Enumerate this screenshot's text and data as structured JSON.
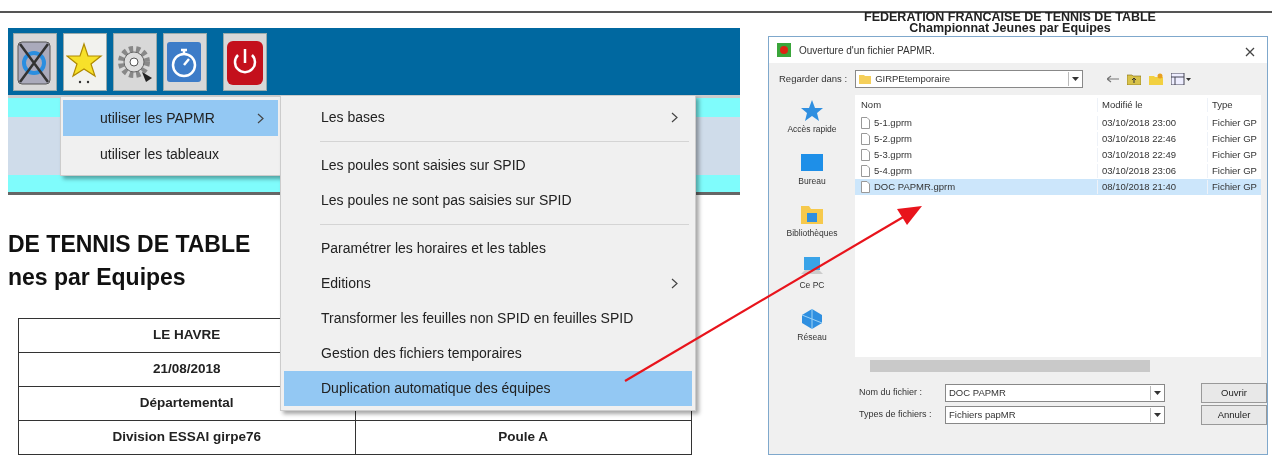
{
  "toolbar": {
    "buttons": [
      {
        "kind": "sync",
        "selected": false
      },
      {
        "kind": "star",
        "selected": true
      },
      {
        "kind": "gear",
        "selected": false
      },
      {
        "kind": "timer",
        "selected": false
      },
      {
        "kind": "power",
        "selected": false
      }
    ]
  },
  "menu": {
    "items": [
      {
        "label": "utiliser les PAPMR",
        "selected": true,
        "submenu": true
      },
      {
        "label": "utiliser les tableaux",
        "selected": false,
        "submenu": false
      }
    ]
  },
  "submenu": {
    "items": [
      {
        "kind": "item",
        "label": "Les bases",
        "selected": false,
        "submenu": true
      },
      {
        "kind": "separator"
      },
      {
        "kind": "item",
        "label": "Les poules sont saisies sur SPID",
        "selected": false,
        "submenu": false
      },
      {
        "kind": "item",
        "label": "Les poules ne sont pas saisies sur SPID",
        "selected": false,
        "submenu": false
      },
      {
        "kind": "separator"
      },
      {
        "kind": "item",
        "label": "Paramétrer les horaires et les tables",
        "selected": false,
        "submenu": false
      },
      {
        "kind": "item",
        "label": "Editions",
        "selected": false,
        "submenu": true
      },
      {
        "kind": "item",
        "label": "Transformer les feuilles non SPID en feuilles SPID",
        "selected": false,
        "submenu": false
      },
      {
        "kind": "item",
        "label": "Gestion des fichiers temporaires",
        "selected": false,
        "submenu": false
      },
      {
        "kind": "item",
        "label": "Duplication automatique des équipes",
        "selected": true,
        "submenu": false
      }
    ]
  },
  "document": {
    "heading": "DE TENNIS DE TABLE",
    "subheading": "nes par Equipes",
    "table": {
      "rows": [
        {
          "cells": [
            "LE HAVRE"
          ]
        },
        {
          "cells": [
            "21/08/2018"
          ]
        },
        {
          "cells": [
            "Départemental"
          ]
        },
        {
          "cells": [
            "Division  ESSAI girpe76",
            "Poule A"
          ]
        }
      ]
    }
  },
  "document_right": {
    "title": "FEDERATION FRANCAISE DE TENNIS DE TABLE",
    "subtitle": "Championnat Jeunes par Equipes"
  },
  "dialog": {
    "title": "Ouverture d'un fichier PAPMR.",
    "look_in_label": "Regarder dans :",
    "look_in_value": "GIRPEtemporaire",
    "places": [
      {
        "kind": "star",
        "label": "Accès rapide"
      },
      {
        "kind": "desktop",
        "label": "Bureau"
      },
      {
        "kind": "library",
        "label": "Bibliothèques"
      },
      {
        "kind": "computer",
        "label": "Ce PC"
      },
      {
        "kind": "network",
        "label": "Réseau"
      }
    ],
    "columns": [
      "Nom",
      "Modifié le",
      "Type"
    ],
    "files": [
      {
        "name": "5-1.gprm",
        "modified": "03/10/2018 23:00",
        "type": "Fichier GP",
        "selected": false
      },
      {
        "name": "5-2.gprm",
        "modified": "03/10/2018 22:46",
        "type": "Fichier GP",
        "selected": false
      },
      {
        "name": "5-3.gprm",
        "modified": "03/10/2018 22:49",
        "type": "Fichier GP",
        "selected": false
      },
      {
        "name": "5-4.gprm",
        "modified": "03/10/2018 23:06",
        "type": "Fichier GP",
        "selected": false
      },
      {
        "name": "DOC PAPMR.gprm",
        "modified": "08/10/2018 21:40",
        "type": "Fichier GP",
        "selected": true
      }
    ],
    "filename_label": "Nom du fichier :",
    "filename_value": "DOC PAPMR",
    "filetype_label": "Types de fichiers :",
    "filetype_value": "Fichiers papMR",
    "buttons": [
      "Ouvrir",
      "Annuler"
    ]
  }
}
